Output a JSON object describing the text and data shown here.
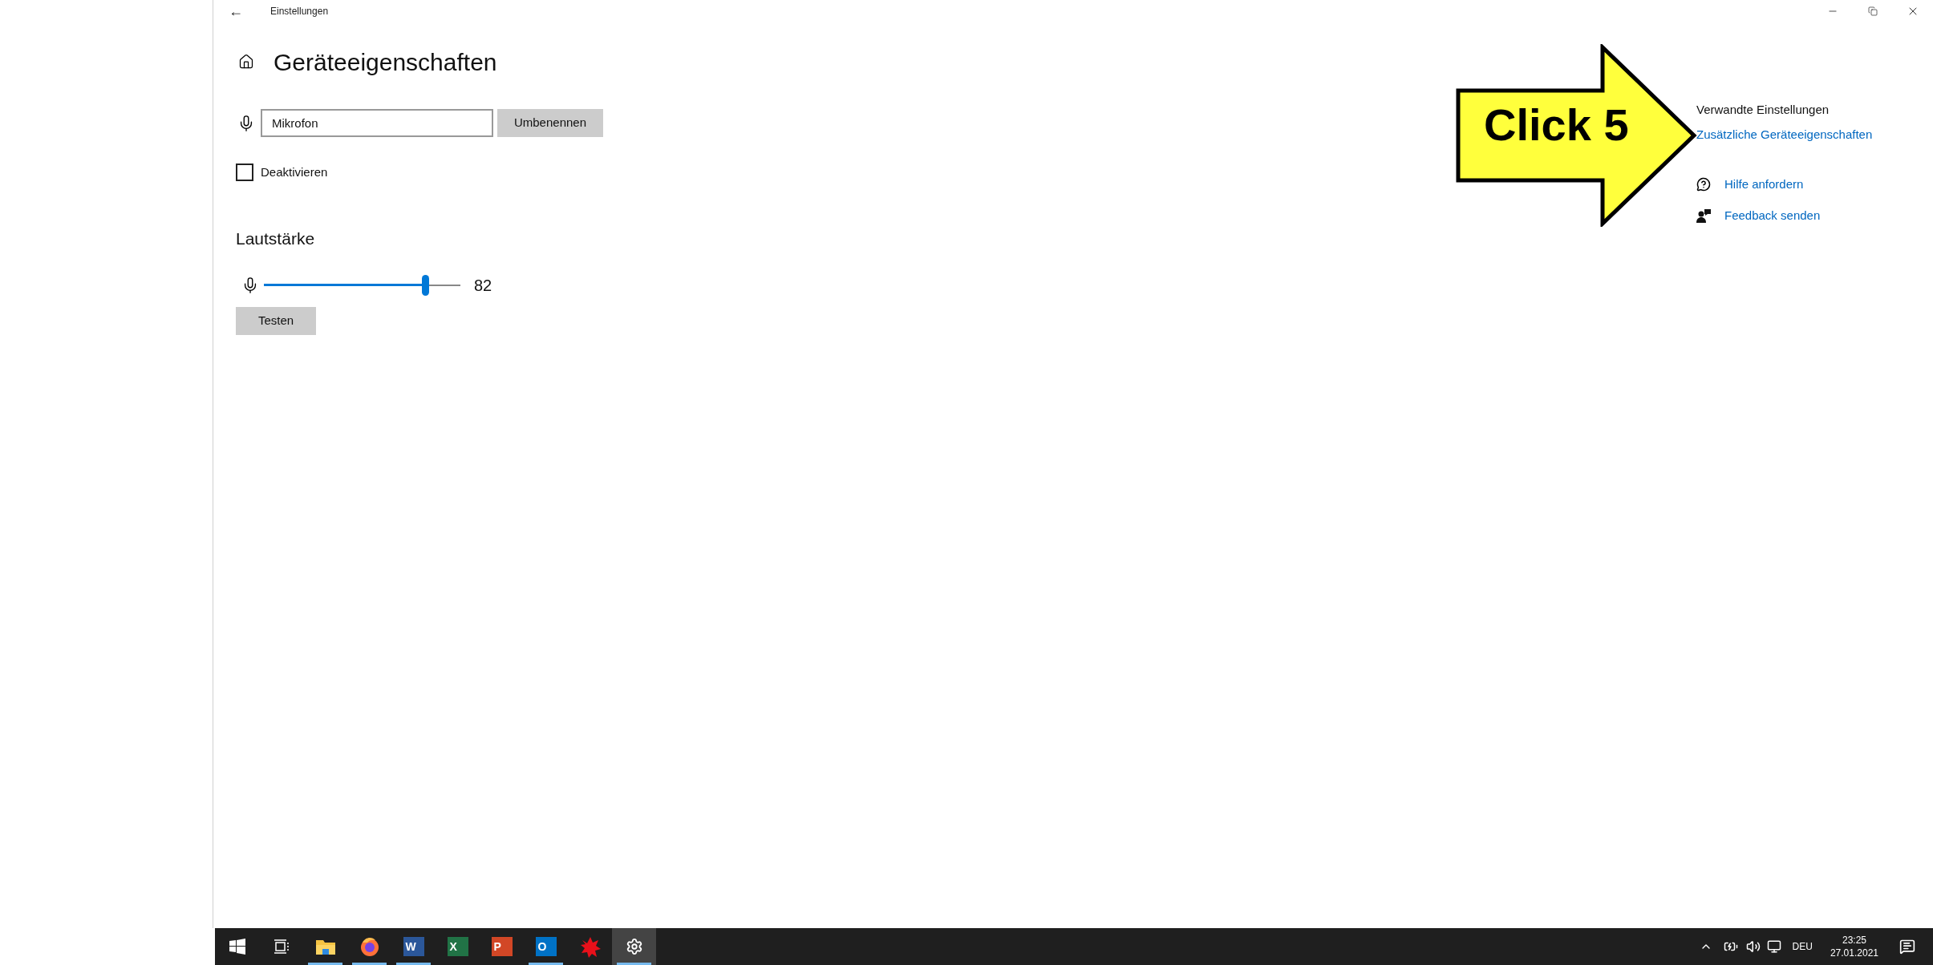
{
  "window": {
    "title": "Einstellungen",
    "back": "←"
  },
  "page": {
    "title": "Geräteeigenschaften"
  },
  "name_field": {
    "value": "Mikrofon"
  },
  "rename_button": "Umbenennen",
  "disable": {
    "label": "Deaktivieren",
    "checked": false
  },
  "volume": {
    "heading": "Lautstärke",
    "level": 0.82,
    "reading": "82"
  },
  "test_button": "Testen",
  "related": {
    "heading": "Verwandte Einstellungen",
    "link": "Zusätzliche Geräteeigenschaften"
  },
  "help_links": [
    {
      "kind": "help",
      "label": "Hilfe anfordern"
    },
    {
      "kind": "feedback",
      "label": "Feedback senden"
    }
  ],
  "callout": {
    "label": "Click 5"
  },
  "taskbar": {
    "apps": [
      {
        "kind": "start",
        "running": false,
        "selected": false
      },
      {
        "kind": "taskview",
        "running": false,
        "selected": false
      },
      {
        "kind": "explorer",
        "running": true,
        "selected": false
      },
      {
        "kind": "firefox",
        "running": true,
        "selected": false
      },
      {
        "kind": "office",
        "letter": "W",
        "color": "#2b579a",
        "running": true,
        "selected": false
      },
      {
        "kind": "office",
        "letter": "X",
        "color": "#217346",
        "running": false,
        "selected": false
      },
      {
        "kind": "office",
        "letter": "P",
        "color": "#d24726",
        "running": false,
        "selected": false
      },
      {
        "kind": "office",
        "letter": "O",
        "color": "#0072c6",
        "running": true,
        "selected": false
      },
      {
        "kind": "splat",
        "running": false,
        "selected": false
      },
      {
        "kind": "settings",
        "running": true,
        "selected": true
      }
    ],
    "language": "DEU",
    "time": "23:25",
    "date": "27.01.2021"
  }
}
